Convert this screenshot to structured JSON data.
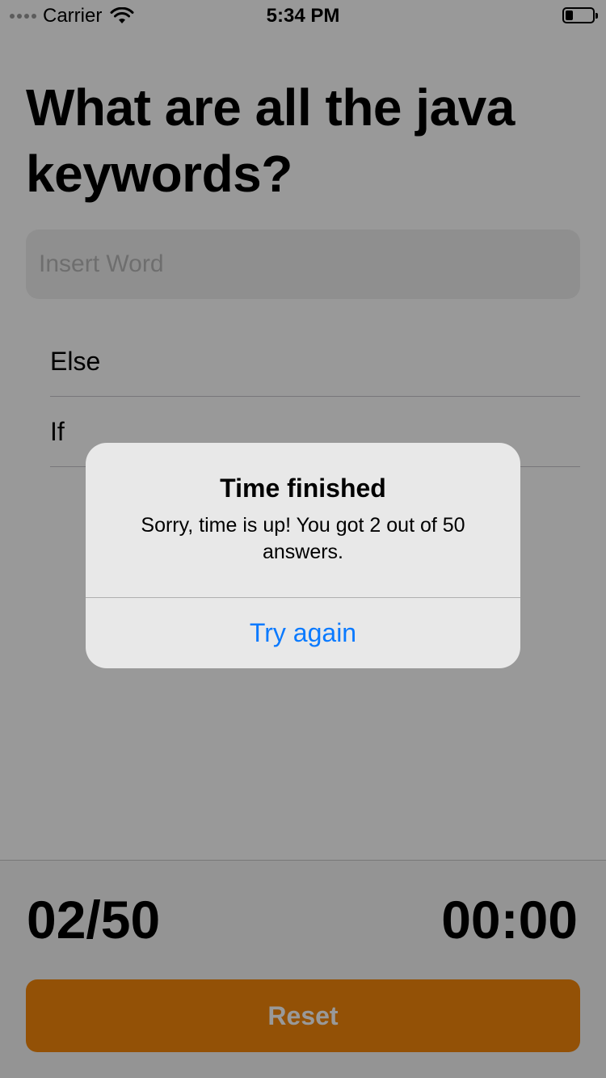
{
  "status_bar": {
    "carrier": "Carrier",
    "time": "5:34 PM"
  },
  "quiz": {
    "question": "What are all the java keywords?",
    "input_placeholder": "Insert Word",
    "answers": [
      {
        "label": "Else"
      },
      {
        "label": "If"
      }
    ]
  },
  "footer": {
    "score": "02/50",
    "timer": "00:00",
    "reset_label": "Reset"
  },
  "alert": {
    "title": "Time finished",
    "message": "Sorry, time is up! You got 2 out of 50 answers.",
    "button_label": "Try again"
  },
  "colors": {
    "accent": "#0a7aff",
    "reset_button": "#f5870a"
  },
  "icons": [
    "signal-dots-icon",
    "wifi-icon",
    "battery-icon"
  ]
}
